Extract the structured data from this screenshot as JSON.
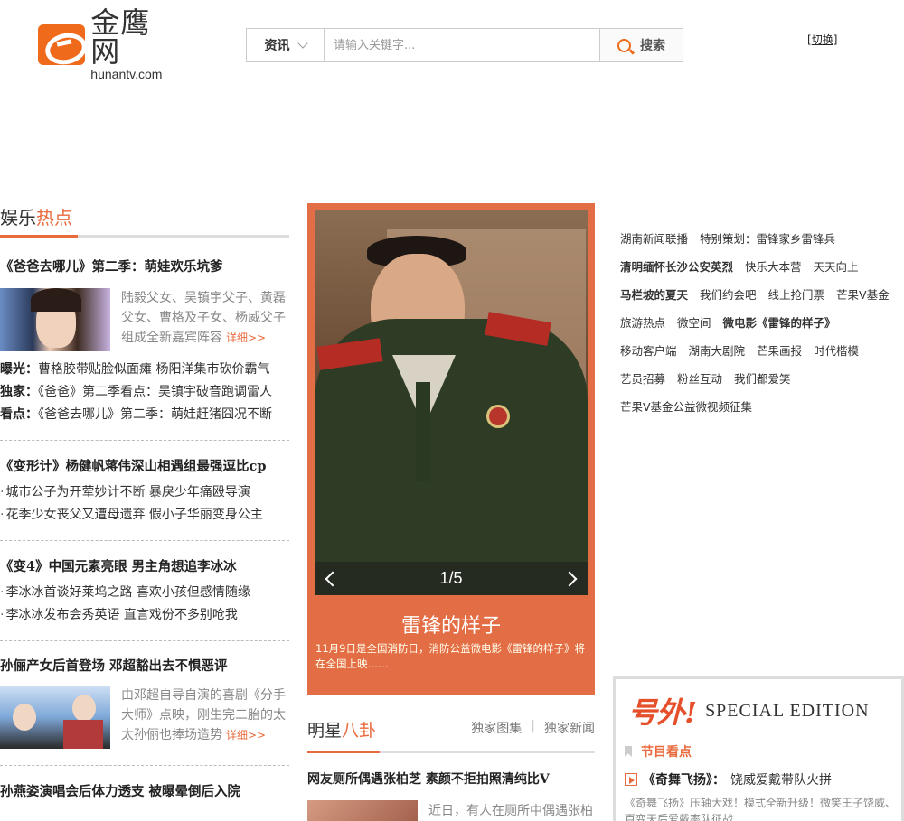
{
  "header": {
    "logo_cn": "金鹰网",
    "logo_en": "hunantv.com",
    "search_category": "资讯",
    "search_placeholder": "请输入关键字...",
    "search_button": "搜索",
    "switch_label": "切换"
  },
  "left": {
    "section_title_a": "娱乐",
    "section_title_b": "热点",
    "block1_title": "《爸爸去哪儿》第二季：萌娃欢乐坑爹",
    "block1_desc": "陆毅父女、吴镇宇父子、黄磊父女、曹格及子女、杨威父子组成全新嘉宾阵容",
    "block1_more": "详细>>",
    "lines": [
      {
        "tag": "曝光：",
        "text": "曹格胶带贴脸似面瘫 杨阳洋集市砍价霸气"
      },
      {
        "tag": "独家：",
        "text": "《爸爸》第二季看点：吴镇宇破音跑调雷人"
      },
      {
        "tag": "看点：",
        "text": "《爸爸去哪儿》第二季：萌娃赶猪囧况不断"
      }
    ],
    "block2_title": "《变形计》杨健帆蒋伟深山相遇组最强逗比cp",
    "block2_items": [
      "城市公子为开荤妙计不断 暴戾少年痛殴导演",
      "花季少女丧父又遭母遗弃 假小子华丽变身公主"
    ],
    "block3_title": "《变4》中国元素亮眼 男主角想追李冰冰",
    "block3_items": [
      "李冰冰首谈好莱坞之路 喜欢小孩但感情随缘",
      "李冰冰发布会秀英语 直言戏份不多别呛我"
    ],
    "block4_title": "孙俪产女后首登场 邓超豁出去不惧恶评",
    "block4_desc": "由邓超自导自演的喜剧《分手大师》点映，刚生完二胎的太太孙俪也捧场造势",
    "block4_more": "详细>>",
    "block5_title": "孙燕姿演唱会后体力透支 被曝晕倒后入院"
  },
  "feature": {
    "counter": "1/5",
    "title": "雷锋的样子",
    "desc": "11月9日是全国消防日，消防公益微电影《雷锋的样子》将在全国上映……"
  },
  "stars": {
    "title_a": "明星",
    "title_b": "八卦",
    "tab1": "独家图集",
    "tab2": "独家新闻",
    "news_title": "网友厕所偶遇张柏芝 素颜不拒拍照清纯比V",
    "news_desc": "近日，有人在厕所中偶遇张柏"
  },
  "tags": [
    [
      {
        "t": "湖南新闻联播",
        "b": false
      },
      {
        "t": "特别策划：雷锋家乡雷锋兵",
        "b": false
      }
    ],
    [
      {
        "t": "清明缅怀长沙公安英烈",
        "b": true
      },
      {
        "t": "快乐大本营",
        "b": false
      },
      {
        "t": "天天向上",
        "b": false
      }
    ],
    [
      {
        "t": "马栏坡的夏天",
        "b": true
      },
      {
        "t": "我们约会吧",
        "b": false
      },
      {
        "t": "线上抢门票",
        "b": false
      },
      {
        "t": "芒果V基金",
        "b": false
      }
    ],
    [
      {
        "t": "旅游热点",
        "b": false
      },
      {
        "t": "微空间",
        "b": false
      },
      {
        "t": "微电影《雷锋的样子》",
        "b": true
      }
    ],
    [
      {
        "t": "移动客户端",
        "b": false
      },
      {
        "t": "湖南大剧院",
        "b": false
      },
      {
        "t": "芒果画报",
        "b": false
      },
      {
        "t": "时代楷模",
        "b": false
      }
    ],
    [
      {
        "t": "艺员招募",
        "b": false
      },
      {
        "t": "粉丝互动",
        "b": false
      },
      {
        "t": "我们都爱笑",
        "b": false
      }
    ],
    [
      {
        "t": "芒果V基金公益微视频征集",
        "b": false
      }
    ]
  ],
  "special": {
    "brand": "号外!",
    "edition": "SPECIAL EDITION",
    "program_head": "节目看点",
    "item_title": "《奇舞飞扬》：",
    "item_text": "饶威爱戴带队火拼",
    "item_desc": "《奇舞飞扬》压轴大戏！模式全新升级！微笑王子饶威、百变天后爱戴率队征战……"
  },
  "colors": {
    "accent": "#e96a3c",
    "feature_bg": "#e36e45",
    "logo": "#ef6a1b"
  }
}
